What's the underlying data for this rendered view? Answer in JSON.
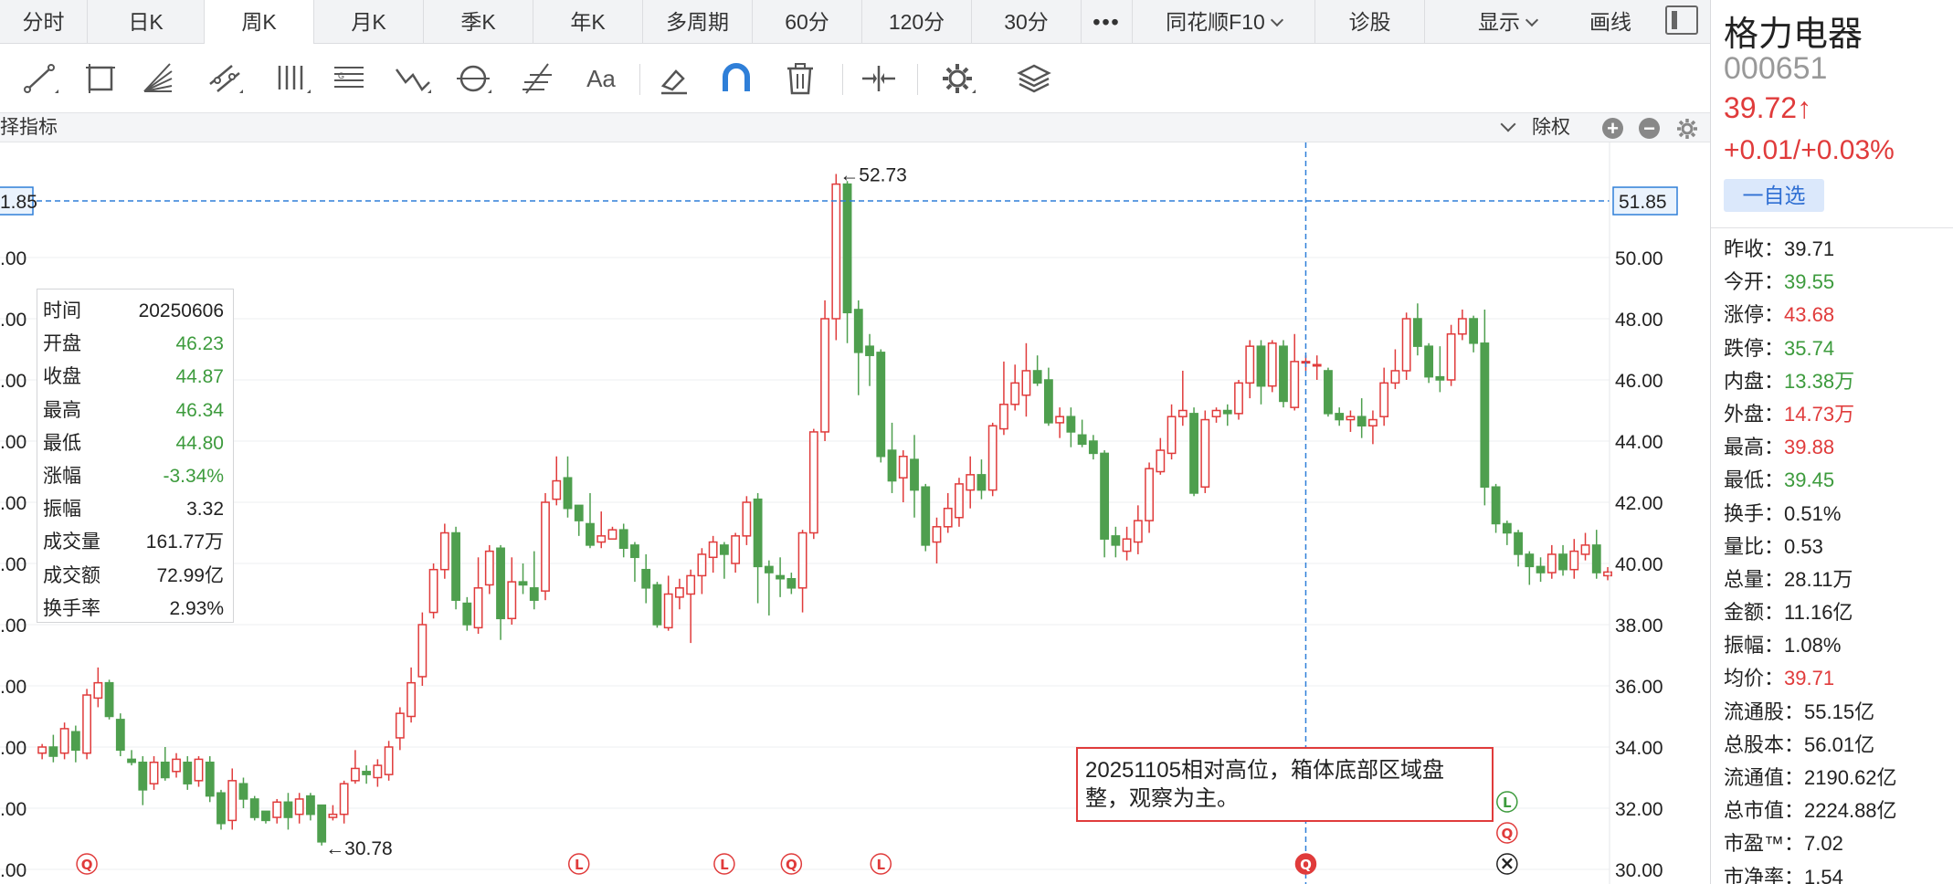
{
  "tabs": [
    {
      "label": "分时",
      "active": false
    },
    {
      "label": "日K",
      "active": false
    },
    {
      "label": "周K",
      "active": true
    },
    {
      "label": "月K",
      "active": false
    },
    {
      "label": "季K",
      "active": false
    },
    {
      "label": "年K",
      "active": false
    },
    {
      "label": "多周期",
      "active": false
    },
    {
      "label": "60分",
      "active": false
    },
    {
      "label": "120分",
      "active": false
    },
    {
      "label": "30分",
      "active": false
    },
    {
      "label": "•••",
      "active": false
    },
    {
      "label": "同花顺F10",
      "active": false
    },
    {
      "label": "诊股",
      "active": false
    }
  ],
  "top_right": {
    "display_label": "显示",
    "draw_label": "画线"
  },
  "toolbar": {
    "text_tool_label": "Aa"
  },
  "sub_bar": {
    "indicator_label": "择指标",
    "exright_label": "除权",
    "plus_label": "+",
    "minus_label": "−"
  },
  "ohlc": {
    "rows": [
      {
        "key": "时间",
        "value": "20250606",
        "color": "black"
      },
      {
        "key": "开盘",
        "value": "46.23",
        "color": "green"
      },
      {
        "key": "收盘",
        "value": "44.87",
        "color": "green"
      },
      {
        "key": "最高",
        "value": "46.34",
        "color": "green"
      },
      {
        "key": "最低",
        "value": "44.80",
        "color": "green"
      },
      {
        "key": "涨幅",
        "value": "-3.34%",
        "color": "green"
      },
      {
        "key": "振幅",
        "value": "3.32",
        "color": "black"
      },
      {
        "key": "成交量",
        "value": "161.77万",
        "color": "black"
      },
      {
        "key": "成交额",
        "value": "72.99亿",
        "color": "black"
      },
      {
        "key": "换手率",
        "value": "2.93%",
        "color": "black"
      }
    ]
  },
  "note": {
    "text": "20251105相对高位，箱体底部区域盘整，观察为主。"
  },
  "chart_data": {
    "type": "candlestick",
    "y_axis_ticks": [
      "30.00",
      "32.00",
      "34.00",
      "36.00",
      "38.00",
      "40.00",
      "42.00",
      "44.00",
      "46.00",
      "48.00",
      "50.00"
    ],
    "y_axis_left_ticks": [
      ".00",
      ".00",
      ".00",
      ".00",
      ".00",
      ".00",
      ".00",
      ".00",
      ".00",
      ".00",
      ".00"
    ],
    "ylim": [
      30,
      52.5
    ],
    "crosshair_price": "51.85",
    "crosshair_price_left": "1.85",
    "annotations": [
      {
        "text": "←52.73",
        "value": 52.73
      },
      {
        "text": "←30.78",
        "value": 30.78
      }
    ],
    "colors": {
      "up": "#e03b3b",
      "down": "#4e9f4e",
      "crosshair": "#2f7fd8"
    },
    "candles": [
      [
        33.8,
        34.0,
        33.6,
        34.1
      ],
      [
        34.0,
        33.7,
        33.5,
        34.4
      ],
      [
        33.8,
        34.6,
        33.6,
        34.8
      ],
      [
        34.5,
        33.9,
        33.5,
        34.7
      ],
      [
        33.8,
        35.7,
        33.6,
        35.9
      ],
      [
        35.6,
        36.1,
        35.3,
        36.6
      ],
      [
        36.1,
        35.0,
        34.9,
        36.2
      ],
      [
        34.9,
        33.9,
        33.7,
        35.1
      ],
      [
        33.6,
        33.5,
        33.4,
        33.9
      ],
      [
        33.5,
        32.6,
        32.1,
        33.7
      ],
      [
        32.8,
        33.5,
        32.6,
        33.7
      ],
      [
        33.5,
        33.0,
        32.9,
        34.0
      ],
      [
        33.2,
        33.6,
        33.0,
        33.8
      ],
      [
        33.5,
        32.8,
        32.6,
        33.7
      ],
      [
        32.9,
        33.6,
        32.7,
        33.7
      ],
      [
        33.5,
        32.4,
        32.2,
        33.7
      ],
      [
        32.5,
        31.5,
        31.3,
        32.6
      ],
      [
        31.6,
        32.9,
        31.3,
        33.3
      ],
      [
        32.8,
        32.3,
        32.0,
        33.0
      ],
      [
        32.3,
        31.7,
        31.6,
        32.4
      ],
      [
        31.9,
        31.6,
        31.5,
        31.7
      ],
      [
        31.7,
        32.2,
        31.5,
        32.3
      ],
      [
        32.2,
        31.7,
        31.3,
        32.5
      ],
      [
        31.8,
        32.3,
        31.5,
        32.5
      ],
      [
        32.4,
        31.8,
        31.6,
        32.5
      ],
      [
        32.1,
        30.9,
        30.78,
        32.0
      ],
      [
        31.7,
        31.8,
        31.6,
        32.1
      ],
      [
        31.8,
        32.8,
        31.5,
        32.9
      ],
      [
        32.9,
        33.3,
        32.8,
        33.9
      ],
      [
        33.2,
        33.1,
        32.8,
        33.4
      ],
      [
        33.0,
        33.4,
        32.7,
        33.6
      ],
      [
        33.1,
        34.0,
        32.9,
        34.2
      ],
      [
        34.3,
        35.1,
        33.9,
        35.3
      ],
      [
        35.0,
        36.1,
        34.8,
        36.6
      ],
      [
        36.3,
        38.0,
        36.0,
        38.4
      ],
      [
        38.4,
        39.8,
        38.2,
        40.0
      ],
      [
        39.8,
        41.0,
        39.5,
        41.3
      ],
      [
        41.0,
        38.8,
        38.5,
        41.2
      ],
      [
        38.7,
        38.0,
        37.8,
        38.9
      ],
      [
        37.9,
        39.2,
        37.7,
        40.2
      ],
      [
        39.3,
        40.4,
        39.0,
        40.6
      ],
      [
        40.5,
        38.2,
        37.5,
        40.6
      ],
      [
        38.2,
        39.4,
        38.0,
        40.2
      ],
      [
        39.4,
        39.3,
        39.0,
        40.0
      ],
      [
        39.2,
        38.8,
        38.5,
        40.4
      ],
      [
        39.1,
        42.0,
        38.8,
        42.3
      ],
      [
        42.1,
        42.7,
        41.9,
        43.5
      ],
      [
        42.8,
        41.8,
        41.5,
        43.5
      ],
      [
        41.9,
        41.4,
        40.9,
        41.9
      ],
      [
        41.3,
        40.6,
        40.5,
        42.3
      ],
      [
        40.7,
        40.9,
        40.5,
        41.7
      ],
      [
        40.8,
        41.1,
        40.8,
        41.2
      ],
      [
        41.1,
        40.5,
        40.2,
        41.3
      ],
      [
        40.6,
        40.2,
        39.4,
        40.7
      ],
      [
        39.8,
        39.2,
        38.7,
        40.3
      ],
      [
        39.3,
        38.0,
        37.9,
        39.4
      ],
      [
        37.9,
        39.0,
        37.8,
        39.6
      ],
      [
        38.9,
        39.2,
        38.5,
        39.5
      ],
      [
        39.0,
        39.6,
        37.4,
        39.8
      ],
      [
        39.6,
        40.3,
        39.0,
        40.5
      ],
      [
        40.2,
        40.7,
        39.7,
        40.9
      ],
      [
        40.6,
        40.3,
        39.5,
        40.7
      ],
      [
        40.0,
        40.9,
        39.7,
        41.0
      ],
      [
        40.9,
        42.0,
        40.6,
        42.2
      ],
      [
        42.1,
        39.9,
        38.7,
        42.3
      ],
      [
        39.9,
        39.7,
        38.3,
        40.1
      ],
      [
        39.6,
        39.5,
        38.9,
        40.2
      ],
      [
        39.5,
        39.2,
        39.0,
        39.7
      ],
      [
        39.2,
        41.0,
        38.4,
        41.1
      ],
      [
        41.0,
        44.3,
        40.8,
        44.4
      ],
      [
        44.3,
        48.0,
        44.0,
        48.6
      ],
      [
        48.0,
        52.4,
        47.3,
        52.73
      ],
      [
        52.4,
        48.2,
        47.2,
        52.5
      ],
      [
        48.3,
        46.9,
        45.5,
        48.6
      ],
      [
        47.1,
        46.8,
        45.8,
        47.5
      ],
      [
        46.9,
        43.5,
        43.3,
        47.0
      ],
      [
        43.7,
        42.7,
        42.3,
        44.6
      ],
      [
        42.8,
        43.5,
        42.0,
        43.7
      ],
      [
        43.4,
        42.4,
        41.5,
        44.2
      ],
      [
        42.5,
        40.6,
        40.4,
        42.6
      ],
      [
        40.7,
        41.2,
        40.0,
        41.5
      ],
      [
        41.2,
        41.8,
        41.0,
        42.3
      ],
      [
        41.5,
        42.6,
        41.2,
        42.8
      ],
      [
        42.4,
        42.9,
        41.8,
        43.5
      ],
      [
        42.9,
        42.4,
        42.1,
        43.4
      ],
      [
        42.4,
        44.5,
        42.2,
        44.6
      ],
      [
        44.4,
        45.2,
        44.2,
        46.6
      ],
      [
        45.2,
        45.9,
        45.0,
        46.5
      ],
      [
        45.5,
        46.3,
        44.8,
        47.2
      ],
      [
        46.3,
        45.9,
        45.8,
        46.8
      ],
      [
        46.0,
        44.6,
        44.5,
        46.4
      ],
      [
        44.6,
        44.8,
        44.1,
        45.1
      ],
      [
        44.8,
        44.3,
        43.8,
        45.1
      ],
      [
        44.2,
        43.9,
        43.8,
        44.7
      ],
      [
        44.0,
        43.6,
        43.4,
        44.2
      ],
      [
        43.6,
        40.8,
        40.2,
        43.7
      ],
      [
        40.9,
        40.6,
        40.2,
        41.2
      ],
      [
        40.4,
        40.8,
        40.1,
        41.2
      ],
      [
        40.7,
        41.4,
        40.3,
        41.9
      ],
      [
        41.4,
        43.1,
        41.0,
        43.3
      ],
      [
        43.0,
        43.7,
        42.9,
        44.1
      ],
      [
        43.6,
        44.8,
        43.4,
        45.2
      ],
      [
        44.8,
        45.0,
        44.5,
        46.3
      ],
      [
        44.9,
        42.3,
        42.2,
        45.1
      ],
      [
        42.5,
        44.7,
        42.3,
        45.0
      ],
      [
        44.8,
        45.0,
        44.6,
        45.1
      ],
      [
        45.0,
        44.9,
        44.5,
        45.2
      ],
      [
        44.9,
        45.9,
        44.7,
        46.0
      ],
      [
        45.9,
        47.1,
        45.4,
        47.3
      ],
      [
        47.1,
        45.8,
        45.2,
        47.3
      ],
      [
        45.8,
        47.2,
        45.6,
        47.3
      ],
      [
        47.1,
        45.3,
        45.1,
        47.3
      ],
      [
        45.1,
        46.6,
        45.0,
        47.5
      ],
      [
        46.6,
        46.6,
        46.3,
        46.8
      ],
      [
        46.5,
        46.5,
        46.0,
        46.8
      ],
      [
        46.3,
        44.9,
        44.8,
        46.4
      ],
      [
        44.9,
        44.7,
        44.5,
        45.1
      ],
      [
        44.7,
        44.8,
        44.3,
        45.0
      ],
      [
        44.8,
        44.5,
        44.1,
        45.4
      ],
      [
        44.5,
        44.7,
        43.9,
        45.0
      ],
      [
        44.8,
        45.9,
        44.5,
        46.4
      ],
      [
        45.9,
        46.3,
        45.7,
        47.0
      ],
      [
        46.3,
        48.0,
        46.0,
        48.2
      ],
      [
        48.0,
        47.1,
        46.8,
        48.5
      ],
      [
        47.1,
        46.1,
        45.9,
        47.2
      ],
      [
        46.1,
        46.0,
        45.6,
        47.1
      ],
      [
        46.0,
        47.5,
        45.8,
        47.8
      ],
      [
        47.5,
        48.0,
        47.3,
        48.3
      ],
      [
        48.0,
        47.2,
        46.9,
        48.1
      ],
      [
        47.2,
        42.5,
        41.9,
        48.3
      ],
      [
        42.5,
        41.3,
        41.0,
        42.6
      ],
      [
        41.3,
        41.0,
        40.6,
        41.4
      ],
      [
        41.0,
        40.3,
        39.9,
        41.1
      ],
      [
        40.3,
        39.9,
        39.3,
        40.4
      ],
      [
        39.9,
        39.7,
        39.4,
        40.2
      ],
      [
        39.7,
        40.3,
        39.5,
        40.6
      ],
      [
        40.3,
        39.8,
        39.6,
        40.6
      ],
      [
        39.8,
        40.4,
        39.5,
        40.8
      ],
      [
        40.3,
        40.6,
        40.1,
        41.0
      ],
      [
        40.6,
        39.7,
        39.5,
        41.1
      ],
      [
        39.6,
        39.72,
        39.45,
        39.88
      ]
    ],
    "markers": [
      {
        "label": "Q",
        "candle_index": 4,
        "style": "red-outline",
        "row": 1
      },
      {
        "label": "L",
        "candle_index": 48,
        "style": "red-outline",
        "row": 1
      },
      {
        "label": "L",
        "candle_index": 61,
        "style": "red-outline",
        "row": 1
      },
      {
        "label": "Q",
        "candle_index": 67,
        "style": "red-outline",
        "row": 1
      },
      {
        "label": "L",
        "candle_index": 75,
        "style": "red-outline",
        "row": 1
      },
      {
        "label": "Q",
        "candle_index": 113,
        "style": "red-filled",
        "row": 1
      },
      {
        "label": "L",
        "candle_index": 131,
        "style": "green-outline",
        "row": 3
      },
      {
        "label": "Q",
        "candle_index": 131,
        "style": "red-outline",
        "row": 2
      },
      {
        "label": "⊗",
        "candle_index": 131,
        "style": "black-outline",
        "row": 1
      }
    ]
  },
  "quote": {
    "name": "格力电器",
    "code": "000651",
    "price": "39.72↑",
    "change": "+0.01/+0.03%",
    "watch_label": "一自选",
    "rows": [
      {
        "key": "昨收：",
        "value": "39.71",
        "color": "black"
      },
      {
        "key": "今开：",
        "value": "39.55",
        "color": "green"
      },
      {
        "key": "涨停：",
        "value": "43.68",
        "color": "red"
      },
      {
        "key": "跌停：",
        "value": "35.74",
        "color": "green"
      },
      {
        "key": "内盘：",
        "value": "13.38万",
        "color": "green"
      },
      {
        "key": "外盘：",
        "value": "14.73万",
        "color": "red"
      },
      {
        "key": "最高：",
        "value": "39.88",
        "color": "red"
      },
      {
        "key": "最低：",
        "value": "39.45",
        "color": "green"
      },
      {
        "key": "换手：",
        "value": "0.51%",
        "color": "black"
      },
      {
        "key": "量比：",
        "value": "0.53",
        "color": "black"
      },
      {
        "key": "总量：",
        "value": "28.11万",
        "color": "black"
      },
      {
        "key": "金额：",
        "value": "11.16亿",
        "color": "black"
      },
      {
        "key": "振幅：",
        "value": "1.08%",
        "color": "black"
      },
      {
        "key": "均价：",
        "value": "39.71",
        "color": "red"
      },
      {
        "key": "流通股：",
        "value": "55.15亿",
        "color": "black"
      },
      {
        "key": "总股本：",
        "value": "56.01亿",
        "color": "black"
      },
      {
        "key": "流通值：",
        "value": "2190.62亿",
        "color": "black"
      },
      {
        "key": "总市值：",
        "value": "2224.88亿",
        "color": "black"
      },
      {
        "key": "市盈™：",
        "value": "7.02",
        "color": "black"
      },
      {
        "key": "市净率：",
        "value": "1.54",
        "color": "black"
      }
    ]
  }
}
